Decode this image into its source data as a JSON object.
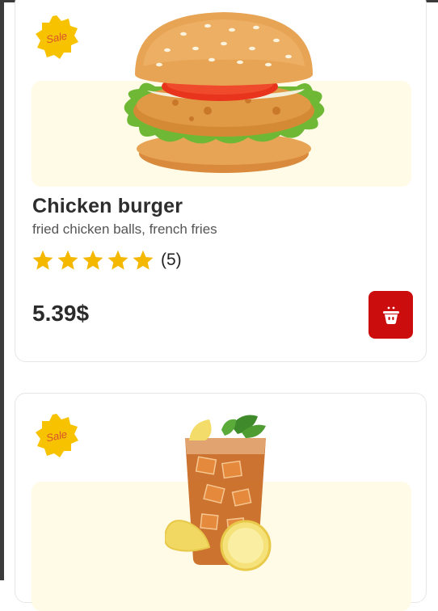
{
  "colors": {
    "accent": "#cc0d0d",
    "star": "#f5b800",
    "sale_badge": "#f7c200",
    "image_bg": "#fffbe6"
  },
  "products": [
    {
      "badge": "Sale",
      "name": "Chicken burger",
      "description": "fried chicken balls, french fries",
      "rating_stars": 5,
      "rating_count": "(5)",
      "price": "5.39$",
      "image": "chicken-burger-image",
      "cart_icon": "basket-icon"
    },
    {
      "badge": "Sale",
      "image": "iced-tea-image"
    }
  ]
}
